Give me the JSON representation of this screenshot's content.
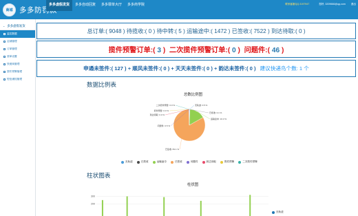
{
  "app": {
    "logo_mark": "商城",
    "title": "多多防罚款"
  },
  "topnav": [
    {
      "label": "多多虚假发货",
      "active": true
    },
    {
      "label": "多多自动回复",
      "active": false
    },
    {
      "label": "多多罪单大厅",
      "active": false
    },
    {
      "label": "多多商学院",
      "active": false
    }
  ],
  "header": {
    "contact": "联系客服QQ:3197947",
    "user": "您好, 3209666@qq.com",
    "logout": "退出"
  },
  "sidebar": {
    "heading": "多多虚假发货",
    "items": [
      {
        "label": "监控数据",
        "active": true
      },
      {
        "label": "店铺管理",
        "active": false
      },
      {
        "label": "订单管理",
        "active": false
      },
      {
        "label": "底单设置",
        "active": false
      },
      {
        "label": "快递商管理",
        "active": false
      },
      {
        "label": "提件预警管理",
        "active": false
      },
      {
        "label": "短信通知管理",
        "active": false
      }
    ]
  },
  "stats": {
    "line1": "总订单:( 9048 )   待揽收:( 0 )   待中转:( 5 )   运输途中:( 1472 )   已签收:( 7522 )   到达待取:( 0 )",
    "warn1_label": "揽件预警订单:(",
    "warn1_value": " 3 ",
    "warn1_close": ")",
    "warn2_label": "二次揽件预警订单:(",
    "warn2_value": " 0 ",
    "warn2_close": ")",
    "warn3_label": "问题件:(",
    "warn3_value": " 46 ",
    "warn3_close": ")",
    "line3": "申通未签件:( 127 ) + 顺风未签件:( 0 ) + 天天未签件:( 0 ) + 韵达未签件:( 0 )",
    "line3_link": "建议快递鸟个数: 1 个"
  },
  "sections": {
    "pie": "数据比例表",
    "bar": "柱状图表"
  },
  "colors": {
    "yilanshou": "#4a9bd9",
    "yiqianshou": "#f5a55c",
    "yunshuzhong": "#92d050",
    "accent": "#1e88c7",
    "border": "#1f77b4",
    "warn": "#e0191c"
  },
  "chart_data": [
    {
      "type": "pie",
      "title": "总数比例图",
      "slices": [
        {
          "name": "无轨迹",
          "value": 0.5,
          "color": "#4a9bd9"
        },
        {
          "name": "已揽收",
          "value": 0.1,
          "color": "#4a4a4a"
        },
        {
          "name": "运输途中",
          "value": 16.3,
          "color": "#92d050"
        },
        {
          "name": "已签收",
          "value": 83.1,
          "color": "#f5a55c"
        },
        {
          "name": "问题件",
          "value": 0.5,
          "color": "#7f6fd1"
        },
        {
          "name": "到达待取",
          "value": 0.0,
          "color": "#e84a6a"
        },
        {
          "name": "揽件预警",
          "value": 0.0,
          "color": "#e8c93a"
        },
        {
          "name": "二次揽件预警",
          "value": 0.0,
          "color": "#38b2a8"
        }
      ],
      "labels": [
        {
          "text": "二次揽件预警: 0.0 %",
          "slice": 7
        },
        {
          "text": "揽件预警: 0.0 %",
          "slice": 6
        },
        {
          "text": "到达待取: 0.0 %",
          "slice": 5
        },
        {
          "text": "问题件: 0.5 %",
          "slice": 4
        },
        {
          "text": "无轨迹: 0.5 %",
          "slice": 0
        },
        {
          "text": "已揽收: 0.1 %",
          "slice": 1
        },
        {
          "text": "运输途中: 16.3 %",
          "slice": 2
        },
        {
          "text": "已签收: 83.1 %",
          "slice": 3
        }
      ],
      "legend_position": "bottom"
    },
    {
      "type": "bar",
      "title": "柱状图",
      "y_ticks": [
        300,
        200
      ],
      "series": [
        {
          "name": "无轨迹",
          "values": [
            250,
            0,
            300,
            0,
            0,
            290,
            0,
            0,
            240,
            0,
            0,
            0,
            320,
            0
          ]
        }
      ],
      "legend_position": "bottom-right"
    }
  ]
}
